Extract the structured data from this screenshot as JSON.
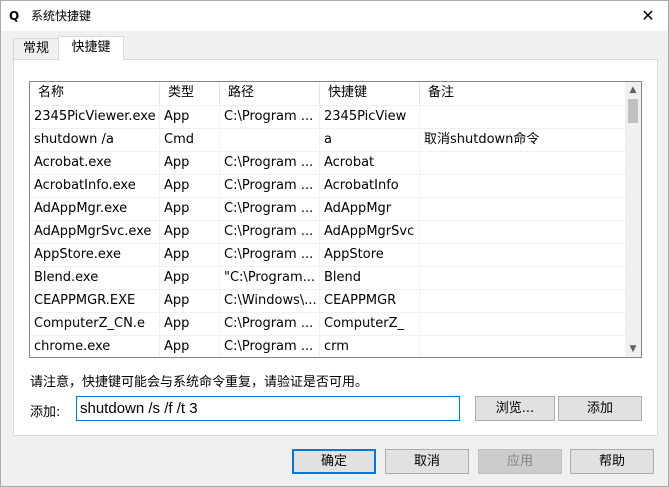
{
  "window": {
    "app_icon": "Q",
    "title": "系统快捷键",
    "close_glyph": "✕"
  },
  "tabs": [
    {
      "label": "常规",
      "active": false
    },
    {
      "label": "快捷键",
      "active": true
    }
  ],
  "table": {
    "columns": [
      "名称",
      "类型",
      "路径",
      "快捷键",
      "备注"
    ],
    "rows": [
      [
        "2345PicViewer.exe",
        "App",
        "C:\\Program ...",
        "2345PicView",
        ""
      ],
      [
        "shutdown /a",
        "Cmd",
        "",
        "a",
        "取消shutdown命令"
      ],
      [
        "Acrobat.exe",
        "App",
        "C:\\Program ...",
        "Acrobat",
        ""
      ],
      [
        "AcrobatInfo.exe",
        "App",
        "C:\\Program ...",
        "AcrobatInfo",
        ""
      ],
      [
        "AdAppMgr.exe",
        "App",
        "C:\\Program ...",
        "AdAppMgr",
        ""
      ],
      [
        "AdAppMgrSvc.exe",
        "App",
        "C:\\Program ...",
        "AdAppMgrSvc",
        ""
      ],
      [
        "AppStore.exe",
        "App",
        "C:\\Program ...",
        "AppStore",
        ""
      ],
      [
        "Blend.exe",
        "App",
        "\"C:\\Program...",
        "Blend",
        ""
      ],
      [
        "CEAPPMGR.EXE",
        "App",
        "C:\\Windows\\...",
        "CEAPPMGR",
        ""
      ],
      [
        "ComputerZ_CN.e",
        "App",
        "C:\\Program ...",
        "ComputerZ_",
        ""
      ],
      [
        "chrome.exe",
        "App",
        "C:\\Program ...",
        "crm",
        ""
      ]
    ],
    "scrollbar": {
      "up_glyph": "▲",
      "down_glyph": "▼"
    }
  },
  "notice": "请注意，快捷键可能会与系统命令重复，请验证是否可用。",
  "add": {
    "label": "添加:",
    "value": "shutdown /s /f /t 3",
    "browse_label": "浏览...",
    "add_label": "添加"
  },
  "footer": {
    "ok_label": "确定",
    "cancel_label": "取消",
    "apply_label": "应用",
    "help_label": "帮助"
  }
}
